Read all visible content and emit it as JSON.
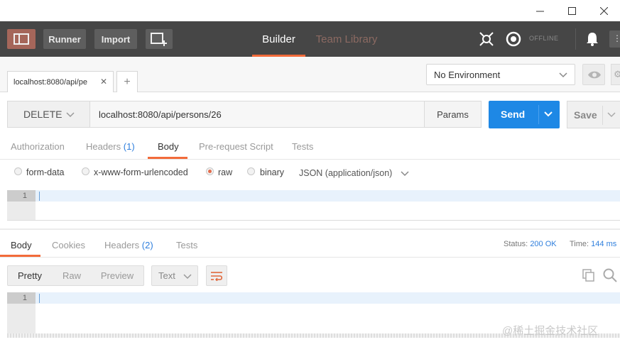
{
  "window": {
    "minimize_glyph": "—",
    "maximize_glyph": "☐",
    "close_glyph": "✕"
  },
  "header": {
    "runner_label": "Runner",
    "import_label": "Import",
    "tabs": [
      {
        "label": "Builder",
        "active": true
      },
      {
        "label": "Team Library",
        "active": false
      }
    ],
    "offline_label": "OFFLINE",
    "icons": [
      "sidebar-toggle-icon",
      "new-window-icon",
      "interceptor-icon",
      "sync-status-icon",
      "notifications-bell-icon",
      "more-icon"
    ]
  },
  "request_tabs": [
    {
      "label": "localhost:8080/api/pe"
    }
  ],
  "add_tab_label": "+",
  "environment": {
    "selected": "No Environment"
  },
  "request": {
    "method": "DELETE",
    "url": "localhost:8080/api/persons/26",
    "params_label": "Params",
    "send_label": "Send",
    "save_label": "Save"
  },
  "request_tabs_nav": [
    {
      "label": "Authorization"
    },
    {
      "label": "Headers",
      "count": "(1)"
    },
    {
      "label": "Body",
      "active": true
    },
    {
      "label": "Pre-request Script"
    },
    {
      "label": "Tests"
    }
  ],
  "body_modes": [
    {
      "label": "form-data",
      "selected": false
    },
    {
      "label": "x-www-form-urlencoded",
      "selected": false
    },
    {
      "label": "raw",
      "selected": true
    },
    {
      "label": "binary",
      "selected": false
    }
  ],
  "content_type": "JSON (application/json)",
  "request_editor": {
    "line": "1"
  },
  "response": {
    "tabs": [
      {
        "label": "Body",
        "active": true
      },
      {
        "label": "Cookies"
      },
      {
        "label": "Headers",
        "count": "(2)"
      },
      {
        "label": "Tests"
      }
    ],
    "status_label": "Status:",
    "status_value": "200 OK",
    "time_label": "Time:",
    "time_value": "144 ms",
    "view_modes": [
      {
        "label": "Pretty",
        "active": true
      },
      {
        "label": "Raw"
      },
      {
        "label": "Preview"
      }
    ],
    "format": "Text",
    "editor_line": "1"
  },
  "watermark": "@稀土掘金技术社区",
  "colors": {
    "header_bg": "#464646",
    "accent_orange": "#f26b3a",
    "send_blue": "#1e88e5",
    "status_blue": "#2f7fdd"
  }
}
